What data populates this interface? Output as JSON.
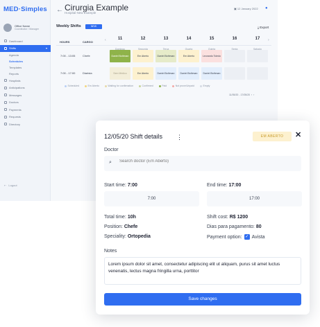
{
  "brand": {
    "part1": "MED",
    "part2": "·Simples"
  },
  "user": {
    "name": "Office Name",
    "role": "Coordinator / Manager"
  },
  "sidebar": {
    "items": [
      {
        "label": "Dashboard"
      },
      {
        "label": "Shifts"
      },
      {
        "label": "Hospitals"
      },
      {
        "label": "Anticipations"
      },
      {
        "label": "Messages"
      },
      {
        "label": "Doctors"
      },
      {
        "label": "Payments"
      },
      {
        "label": "Requests"
      },
      {
        "label": "Directory"
      }
    ],
    "sub": [
      "Agenda",
      "Schedules",
      "Templates",
      "Reports"
    ],
    "logout": "Logout"
  },
  "page": {
    "title": "Cirurgia Example",
    "subtitle": "Hospital New Example",
    "date": "12 January 2022"
  },
  "weekly": {
    "label": "Weekly Shifts",
    "badge": "NEW",
    "export": "Export"
  },
  "table": {
    "col_hours": "HOURS",
    "col_role": "CARGO",
    "days": [
      {
        "num": "11",
        "name": "Domingo"
      },
      {
        "num": "12",
        "name": "Segunda"
      },
      {
        "num": "13",
        "name": "Terca"
      },
      {
        "num": "14",
        "name": "Quarta"
      },
      {
        "num": "15",
        "name": "Quinta"
      },
      {
        "num": "16",
        "name": "Sexta"
      },
      {
        "num": "17",
        "name": "Sabado"
      }
    ],
    "rows": [
      {
        "hours": "7:00 - 13:05",
        "role": "Chefe",
        "cells": [
          "Daniel Bothman",
          "Em Aberto",
          "Daniel Bothman",
          "Em Aberto",
          "Leonardo Toledo",
          "",
          ""
        ]
      },
      {
        "hours": "7:00 - 17:00",
        "role": "Diarista",
        "cells": [
          "Sem Médico",
          "Em Aberto",
          "Daniel Bothman",
          "Daniel Bothman",
          "Daniel Bothman",
          "",
          ""
        ]
      }
    ]
  },
  "legend": [
    "Scheduled",
    "Em Aberto",
    "Waiting for confirmation",
    "Confirmed",
    "Paid",
    "Not prove/Unpaid",
    "Empty"
  ],
  "range": "11/05/20 - 17/05/20",
  "colors": {
    "accent": "#2f6df0",
    "open": "#fdf1cf",
    "paid": "#8fb34a",
    "unpaid": "#fbe0df",
    "confirmed": "#e6ebc9",
    "scheduled": "#e3eefc"
  },
  "modal": {
    "title": "12/05/20 Shift details",
    "status": "EM ABERTO",
    "doctor_label": "Doctor",
    "doctor_placeholder": "Search doctor (Em Aberto)",
    "start_label": "Start time:",
    "start_value": "7:00",
    "start_input": "7:00",
    "end_label": "End time:",
    "end_value": "17:00",
    "end_input": "17:00",
    "total_label": "Total time:",
    "total_value": "10h",
    "cost_label": "Shift cost:",
    "cost_value": "R$ 1200",
    "position_label": "Position:",
    "position_value": "Chefe",
    "days_label": "Dias para pagamento:",
    "days_value": "80",
    "speciality_label": "Speciality:",
    "speciality_value": "Ortopedia",
    "payment_label": "Payment option:",
    "payment_value": "Avista",
    "notes_label": "Notes",
    "notes_text": "Lorem ipsum dolor sit amet, consectetur adipiscing elit ut aliquam, purus sit amet luctus venenatis, lectus magna fringilla urna, porttitor",
    "save_label": "Save changes"
  }
}
